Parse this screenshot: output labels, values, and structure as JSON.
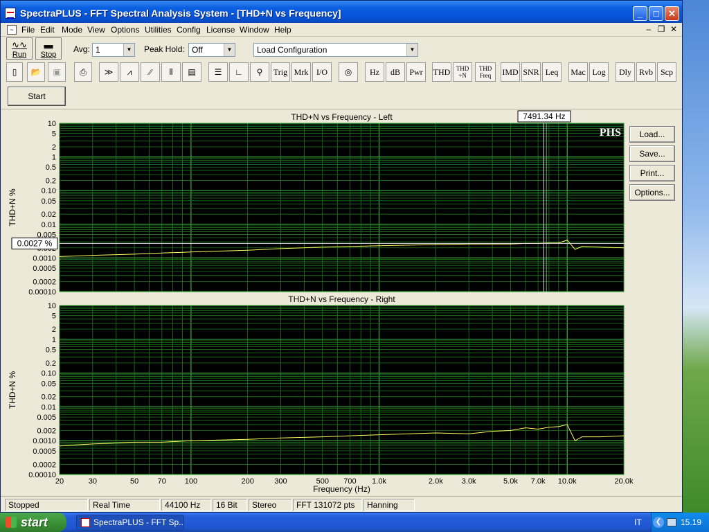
{
  "window": {
    "title": "SpectraPLUS - FFT Spectral Analysis System - [THD+N vs Frequency]"
  },
  "menus": [
    "File",
    "Edit",
    "Mode",
    "View",
    "Options",
    "Utilities",
    "Config",
    "License",
    "Window",
    "Help"
  ],
  "controls": {
    "run_label": "Run",
    "stop_label": "Stop",
    "avg_label": "Avg:",
    "avg_value": "1",
    "peak_hold_label": "Peak Hold:",
    "peak_hold_value": "Off",
    "config_value": "Load Configuration",
    "start_label": "Start"
  },
  "toolbar": {
    "text_buttons": [
      "Trig",
      "Mrk",
      "I/O",
      "Hz",
      "dB",
      "Pwr",
      "THD",
      "IMD",
      "SNR",
      "Leq",
      "Mac",
      "Log",
      "Dly",
      "Rvb",
      "Scp"
    ],
    "thdn_top": "THD",
    "thdn_bottom": "+N",
    "thdfreq_top": "THD",
    "thdfreq_bottom": "Freq"
  },
  "side_buttons": [
    "Load...",
    "Save...",
    "Print...",
    "Options..."
  ],
  "cursor": {
    "freq_readout": "7491.34 Hz",
    "value_readout": "0.0027 %",
    "freq_value": 7491.34,
    "value": 0.0027
  },
  "logo_text": "PHS",
  "status": [
    "Stopped",
    "Real Time",
    "44100 Hz",
    "16 Bit",
    "Stereo",
    "FFT 131072 pts",
    "Hanning"
  ],
  "taskbar": {
    "start_label": "start",
    "task_label": "SpectraPLUS - FFT Sp...",
    "lang": "IT",
    "clock": "15.19"
  },
  "chart_data": [
    {
      "type": "line",
      "title": "THD+N vs Frequency - Left",
      "ylabel": "THD+N %",
      "xlabel": "",
      "xscale": "log",
      "yscale": "log",
      "xlim": [
        20,
        20000
      ],
      "ylim": [
        0.0001,
        10
      ],
      "grid": true,
      "x_ticks": [
        20,
        30,
        50,
        70,
        100,
        200,
        300,
        500,
        700,
        1000,
        2000,
        3000,
        5000,
        7000,
        10000,
        20000
      ],
      "y_ticks": [
        10,
        5,
        2,
        1,
        0.5,
        0.2,
        0.1,
        0.05,
        0.02,
        0.01,
        0.005,
        0.002,
        0.001,
        0.0005,
        0.0002,
        0.0001
      ],
      "y_tick_labels": [
        "10",
        "5",
        "2",
        "1",
        "0.5",
        "0.2",
        "0.10",
        "0.05",
        "0.02",
        "0.01",
        "0.005",
        "0.002",
        "0.0010",
        "0.0005",
        "0.0002",
        "0.00010"
      ],
      "series": [
        {
          "x": [
            20,
            30,
            50,
            70,
            100,
            200,
            300,
            500,
            700,
            1000,
            2000,
            3000,
            5000,
            6000,
            7000,
            8000,
            9000,
            10000,
            11000,
            12000,
            15000,
            20000
          ],
          "y": [
            0.0011,
            0.0012,
            0.0013,
            0.0014,
            0.0015,
            0.0017,
            0.0019,
            0.0021,
            0.0022,
            0.0023,
            0.0025,
            0.0026,
            0.0026,
            0.0027,
            0.0027,
            0.0028,
            0.0028,
            0.0034,
            0.0018,
            0.0022,
            0.0021,
            0.002
          ]
        }
      ]
    },
    {
      "type": "line",
      "title": "THD+N vs Frequency - Right",
      "ylabel": "THD+N %",
      "xlabel": "Frequency (Hz)",
      "xscale": "log",
      "yscale": "log",
      "xlim": [
        20,
        20000
      ],
      "ylim": [
        0.0001,
        10
      ],
      "grid": true,
      "x_ticks": [
        20,
        30,
        50,
        70,
        100,
        200,
        300,
        500,
        700,
        1000,
        2000,
        3000,
        5000,
        7000,
        10000,
        20000
      ],
      "x_tick_labels": [
        "20",
        "30",
        "50",
        "70",
        "100",
        "200",
        "300",
        "500",
        "700",
        "1.0k",
        "2.0k",
        "3.0k",
        "5.0k",
        "7.0k",
        "10.0k",
        "20.0k"
      ],
      "y_ticks": [
        10,
        5,
        2,
        1,
        0.5,
        0.2,
        0.1,
        0.05,
        0.02,
        0.01,
        0.005,
        0.002,
        0.001,
        0.0005,
        0.0002,
        0.0001
      ],
      "y_tick_labels": [
        "10",
        "5",
        "2",
        "1",
        "0.5",
        "0.2",
        "0.10",
        "0.05",
        "0.02",
        "0.01",
        "0.005",
        "0.002",
        "0.0010",
        "0.0005",
        "0.0002",
        "0.00010"
      ],
      "series": [
        {
          "x": [
            20,
            30,
            50,
            70,
            100,
            200,
            300,
            500,
            700,
            1000,
            2000,
            3000,
            4000,
            5000,
            6000,
            7000,
            8000,
            9000,
            10000,
            11000,
            12000,
            15000,
            20000
          ],
          "y": [
            0.0007,
            0.0008,
            0.0009,
            0.0009,
            0.001,
            0.0011,
            0.0012,
            0.0013,
            0.0014,
            0.0015,
            0.0017,
            0.0016,
            0.0019,
            0.002,
            0.0024,
            0.0022,
            0.0025,
            0.0026,
            0.003,
            0.001,
            0.0013,
            0.0013,
            0.0014
          ]
        }
      ]
    }
  ]
}
